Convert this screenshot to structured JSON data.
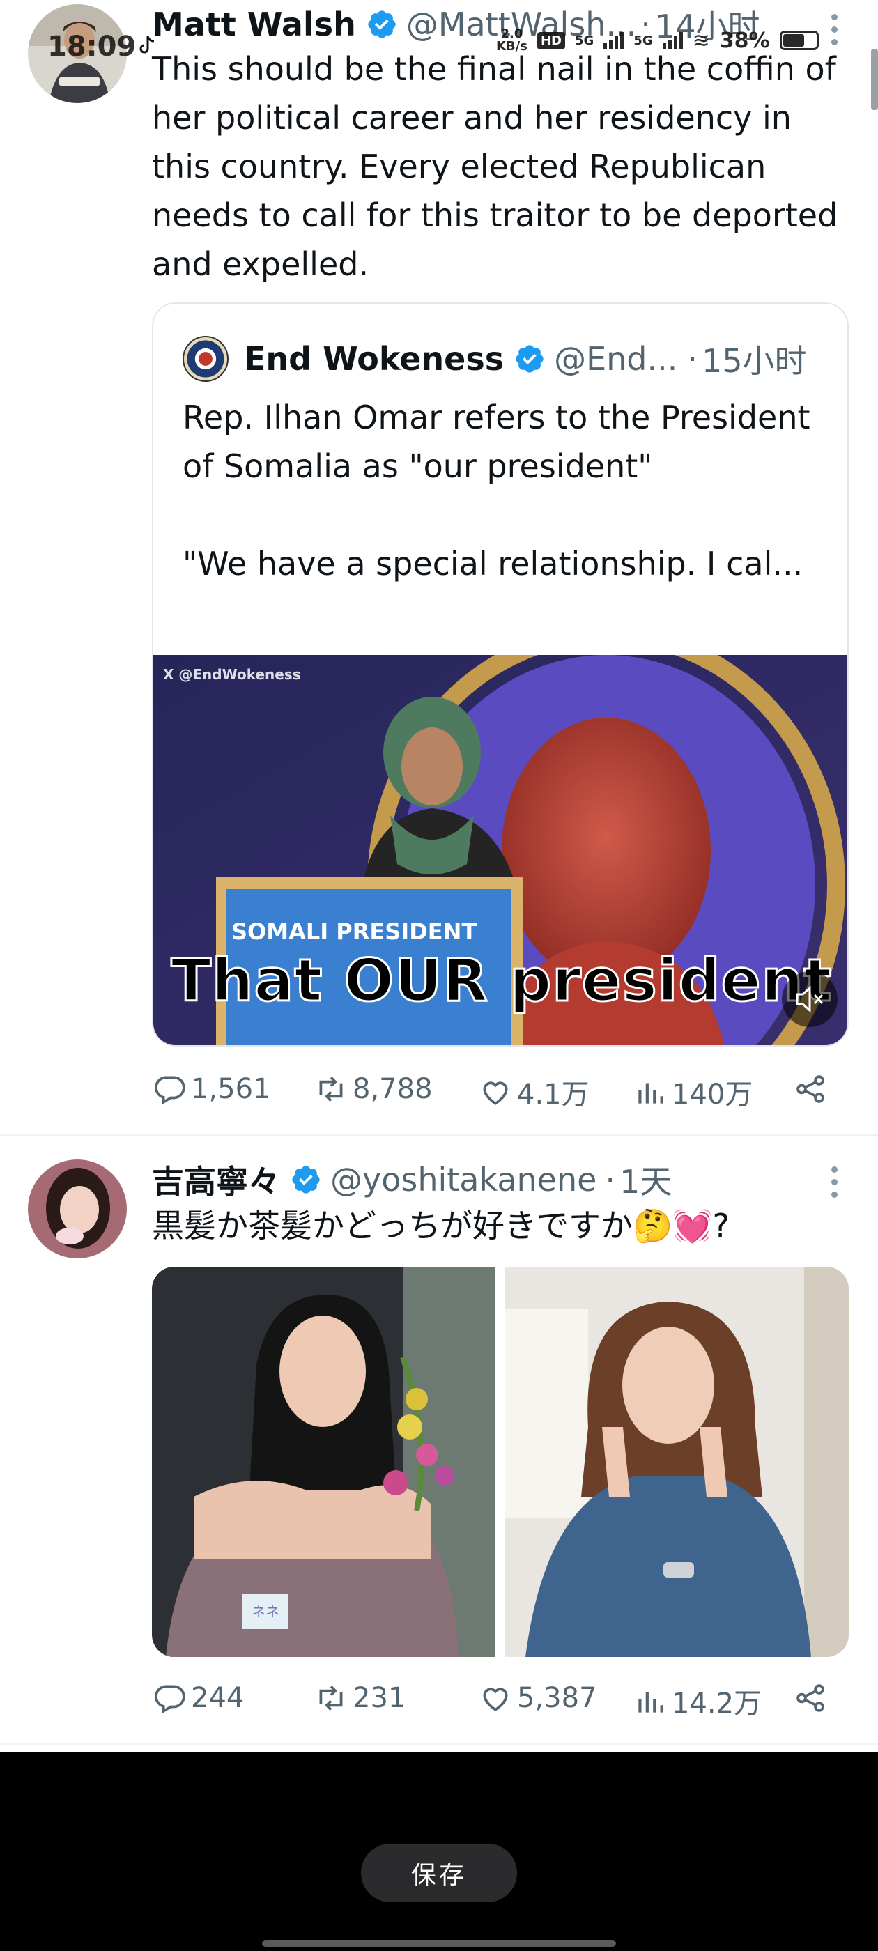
{
  "status_bar": {
    "time": "18:09",
    "net_speed_value": "2.0",
    "net_speed_unit": "KB/s",
    "hd_badge": "HD",
    "net1": "5G",
    "net2": "5G",
    "battery": "38%",
    "icons": [
      "tiktok-notification-icon",
      "signal-icon",
      "wifi-icon",
      "battery-icon"
    ]
  },
  "colors": {
    "verified": "#1d9bf0",
    "text": "#0f1419",
    "secondary": "#536471",
    "divider": "#eff3f4"
  },
  "tweet1": {
    "name": "Matt Walsh",
    "handle": "@MattWalsh...",
    "dot": "·",
    "time": "14小时",
    "text": "This should be the final nail in the coffin of her political career and her residency in this country. Every elected  Republican needs to call for this traitor to be deported and expelled.",
    "quote": {
      "name": "End Wokeness",
      "handle": "@End...",
      "dot": "·",
      "time": "15小时",
      "text_line1": "Rep. Ilhan Omar refers to the President of Somalia as \"our president\"",
      "text_line2": "\"We have a special relationship. I cal...",
      "media": {
        "watermark": "X @EndWokeness",
        "podium_sign": "SOMALI PRESIDENT",
        "caption": "That OUR president",
        "mute_icon": "speaker-muted-icon"
      }
    },
    "actions": {
      "replies": "1,561",
      "reposts": "8,788",
      "likes": "4.1万",
      "views": "140万"
    }
  },
  "tweet2": {
    "name": "吉高寧々",
    "handle": "@yoshitakanene",
    "dot": "·",
    "time": "1天",
    "text": "黒髪か茶髪かどっちが好きですか🤔💓?",
    "photo_label": "ネネ",
    "actions": {
      "replies": "244",
      "reposts": "231",
      "likes": "5,387",
      "views": "14.2万"
    }
  },
  "bottom": {
    "save_label": "保存"
  }
}
